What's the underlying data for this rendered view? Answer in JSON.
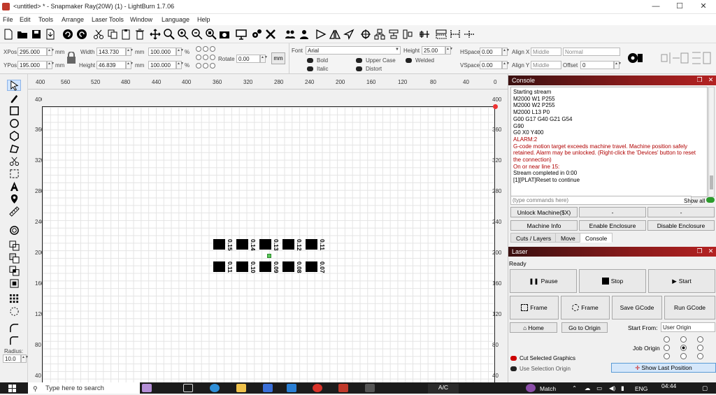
{
  "window": {
    "title": "<untitled> * - Snapmaker Ray(20W) (1) - LightBurn 1.7.06",
    "minimize": "—",
    "maximize": "☐",
    "close": "✕"
  },
  "menu": [
    "File",
    "Edit",
    "Tools",
    "Arrange",
    "Laser Tools",
    "Window",
    "Language",
    "Help"
  ],
  "props": {
    "xpos_label": "XPos",
    "xpos": "295.000",
    "ypos_label": "YPos",
    "ypos": "195.000",
    "unit": "mm",
    "width_label": "Width",
    "width": "143.730",
    "height_label": "Height",
    "height": "46.839",
    "scale_w": "100.000",
    "scale_h": "100.000",
    "pct": "%",
    "rotate_label": "Rotate",
    "rotate": "0.00",
    "mm_button": "mm",
    "font_label": "Font",
    "font": "Arial",
    "fheight_label": "Height",
    "fheight": "25.00",
    "hspace_label": "HSpace",
    "hspace": "0.00",
    "vspace_label": "VSpace",
    "vspace": "0.00",
    "alignx_label": "Align X",
    "alignx": "Middle",
    "aligny_label": "Align Y",
    "aligny": "Middle",
    "style": "Normal",
    "offset_label": "Offset",
    "offset": "0",
    "bold": "Bold",
    "italic": "Italic",
    "uppercase": "Upper Case",
    "distort": "Distort",
    "welded": "Welded"
  },
  "hruler": [
    "560",
    "520",
    "480",
    "440",
    "400",
    "360",
    "320",
    "280",
    "240",
    "200",
    "160",
    "120",
    "80",
    "40"
  ],
  "hruler_left": "400",
  "hruler_right": "0",
  "vruler": [
    "400",
    "360",
    "320",
    "280",
    "240",
    "200",
    "160",
    "120",
    "80",
    "40"
  ],
  "vruler_right": [
    "400",
    "360",
    "320",
    "280",
    "240",
    "200",
    "160",
    "120",
    "80",
    "40"
  ],
  "lefttools": {
    "radius_label": "Radius:",
    "radius": "10.0"
  },
  "canvas": {
    "row1": [
      "0.15",
      "0.14",
      "0.13",
      "0.12",
      "0.11"
    ],
    "row2": [
      "0.11",
      "0.10",
      "0.09",
      "0.08",
      "0.07"
    ]
  },
  "console": {
    "title": "Console",
    "lines": [
      {
        "t": "Starting stream",
        "red": false
      },
      {
        "t": "M2000 W1 P255",
        "red": false
      },
      {
        "t": "M2000 W2 P255",
        "red": false
      },
      {
        "t": "M2000 L13 P0",
        "red": false
      },
      {
        "t": "G00 G17 G40 G21 G54",
        "red": false
      },
      {
        "t": "G90",
        "red": false
      },
      {
        "t": "G0 X0 Y400",
        "red": false
      },
      {
        "t": "ALARM:2",
        "red": true
      },
      {
        "t": "G-code motion target exceeds machine travel. Machine position safely retained. Alarm may be unlocked. (Right-click the 'Devices' button to reset the connection)",
        "red": true
      },
      {
        "t": "On or near line 15:",
        "red": true
      },
      {
        "t": "Stream completed in 0:00",
        "red": false
      },
      {
        "t": "[1][PLAT]Reset to continue",
        "red": false
      }
    ],
    "command_placeholder": "(type commands here)",
    "show_all": "Show all",
    "buttons": [
      "Unlock Machine($X)",
      "-",
      "-",
      "Machine Info",
      "Enable Enclosure",
      "Disable Enclosure"
    ],
    "tabs": [
      "Cuts / Layers",
      "Move",
      "Console"
    ]
  },
  "laser": {
    "title": "Laser",
    "status": "Ready",
    "pause": "Pause",
    "stop": "Stop",
    "start": "Start",
    "frame1": "Frame",
    "frame2": "Frame",
    "save_gcode": "Save GCode",
    "run_gcode": "Run GCode",
    "home": "Home",
    "go_origin": "Go to Origin",
    "start_from_label": "Start From:",
    "start_from": "User Origin",
    "job_origin": "Job Origin",
    "cut_selected": "Cut Selected Graphics",
    "use_selection": "Use Selection Origin",
    "show_last": "Show Last Position"
  },
  "taskbar": {
    "search": "Type here to search",
    "ac": "A/C",
    "match": "Match",
    "lang": "ENG",
    "time": "04:44"
  }
}
